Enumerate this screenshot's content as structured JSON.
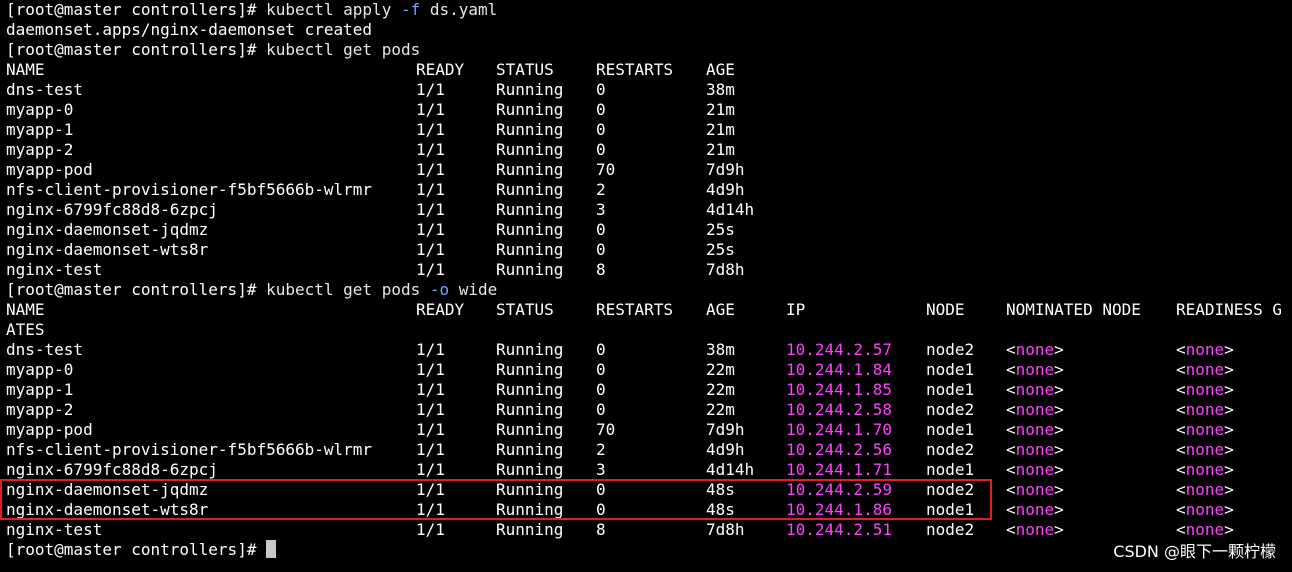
{
  "prompt": "[root@master controllers]# ",
  "cmd1": {
    "pre": "kubectl apply ",
    "flag": "-f",
    "post": " ds.yaml"
  },
  "out1": "daemonset.apps/nginx-daemonset created",
  "cmd2": {
    "pre": "kubectl get pods",
    "flag": "",
    "post": ""
  },
  "table1": {
    "headers": [
      "NAME",
      "READY",
      "STATUS",
      "RESTARTS",
      "AGE"
    ],
    "rows": [
      [
        "dns-test",
        "1/1",
        "Running",
        "0",
        "38m"
      ],
      [
        "myapp-0",
        "1/1",
        "Running",
        "0",
        "21m"
      ],
      [
        "myapp-1",
        "1/1",
        "Running",
        "0",
        "21m"
      ],
      [
        "myapp-2",
        "1/1",
        "Running",
        "0",
        "21m"
      ],
      [
        "myapp-pod",
        "1/1",
        "Running",
        "70",
        "7d9h"
      ],
      [
        "nfs-client-provisioner-f5bf5666b-wlrmr",
        "1/1",
        "Running",
        "2",
        "4d9h"
      ],
      [
        "nginx-6799fc88d8-6zpcj",
        "1/1",
        "Running",
        "3",
        "4d14h"
      ],
      [
        "nginx-daemonset-jqdmz",
        "1/1",
        "Running",
        "0",
        "25s"
      ],
      [
        "nginx-daemonset-wts8r",
        "1/1",
        "Running",
        "0",
        "25s"
      ],
      [
        "nginx-test",
        "1/1",
        "Running",
        "8",
        "7d8h"
      ]
    ]
  },
  "cmd3": {
    "pre": "kubectl get pods ",
    "flag": "-o",
    "post": " wide"
  },
  "table2": {
    "headers": [
      "NAME",
      "READY",
      "STATUS",
      "RESTARTS",
      "AGE",
      "IP",
      "NODE",
      "NOMINATED NODE",
      "READINESS G"
    ],
    "header_wrap": "ATES",
    "rows": [
      [
        "dns-test",
        "1/1",
        "Running",
        "0",
        "38m",
        "10.244.2.57",
        "node2"
      ],
      [
        "myapp-0",
        "1/1",
        "Running",
        "0",
        "22m",
        "10.244.1.84",
        "node1"
      ],
      [
        "myapp-1",
        "1/1",
        "Running",
        "0",
        "22m",
        "10.244.1.85",
        "node1"
      ],
      [
        "myapp-2",
        "1/1",
        "Running",
        "0",
        "22m",
        "10.244.2.58",
        "node2"
      ],
      [
        "myapp-pod",
        "1/1",
        "Running",
        "70",
        "7d9h",
        "10.244.1.70",
        "node1"
      ],
      [
        "nfs-client-provisioner-f5bf5666b-wlrmr",
        "1/1",
        "Running",
        "2",
        "4d9h",
        "10.244.2.56",
        "node2"
      ],
      [
        "nginx-6799fc88d8-6zpcj",
        "1/1",
        "Running",
        "3",
        "4d14h",
        "10.244.1.71",
        "node1"
      ],
      [
        "nginx-daemonset-jqdmz",
        "1/1",
        "Running",
        "0",
        "48s",
        "10.244.2.59",
        "node2"
      ],
      [
        "nginx-daemonset-wts8r",
        "1/1",
        "Running",
        "0",
        "48s",
        "10.244.1.86",
        "node1"
      ],
      [
        "nginx-test",
        "1/1",
        "Running",
        "8",
        "7d8h",
        "10.244.2.51",
        "node2"
      ]
    ],
    "none_value": "none"
  },
  "watermark": "CSDN @眼下一颗柠檬",
  "colors": {
    "ip": "#ff40ff",
    "flag": "#6fa8ff",
    "highlight": "#e02020"
  }
}
